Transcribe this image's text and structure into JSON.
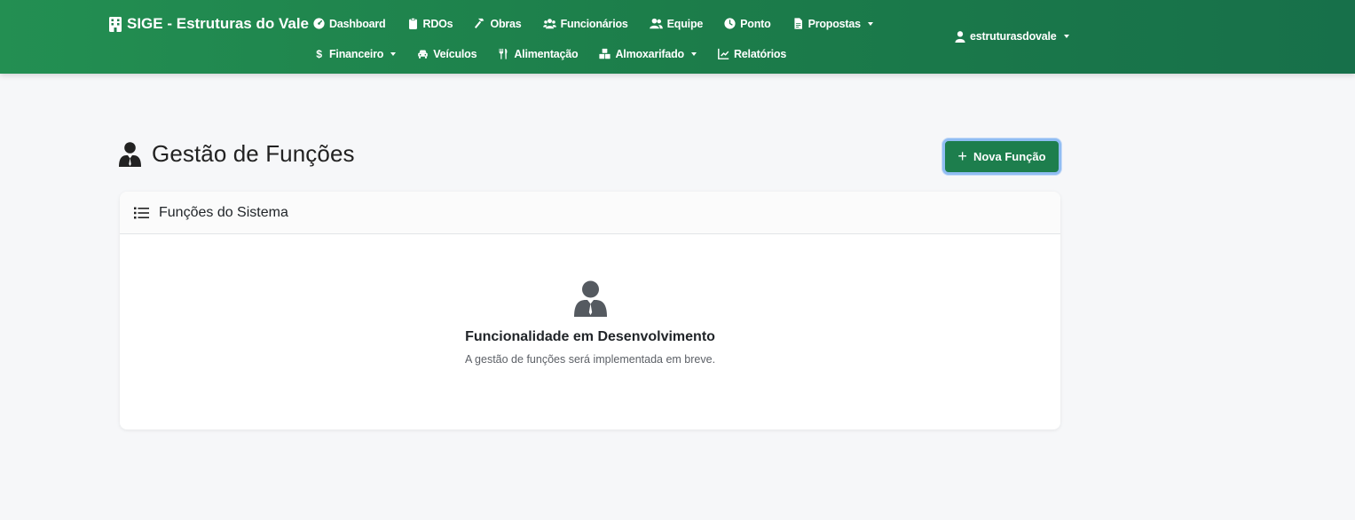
{
  "brand": {
    "title": "SIGE - Estruturas do Vale",
    "icon": "building-icon"
  },
  "nav": {
    "row1": [
      {
        "label": "Dashboard",
        "icon": "gauge-icon",
        "dropdown": false
      },
      {
        "label": "RDOs",
        "icon": "clipboard-icon",
        "dropdown": false
      },
      {
        "label": "Obras",
        "icon": "hammer-icon",
        "dropdown": false
      },
      {
        "label": "Funcionários",
        "icon": "users-icon",
        "dropdown": false
      },
      {
        "label": "Equipe",
        "icon": "user-group-icon",
        "dropdown": false
      },
      {
        "label": "Ponto",
        "icon": "clock-icon",
        "dropdown": false
      },
      {
        "label": "Propostas",
        "icon": "file-icon",
        "dropdown": true
      }
    ],
    "row2": [
      {
        "label": "Financeiro",
        "icon": "dollar-icon",
        "dropdown": true
      },
      {
        "label": "Veículos",
        "icon": "car-icon",
        "dropdown": false
      },
      {
        "label": "Alimentação",
        "icon": "utensils-icon",
        "dropdown": false
      },
      {
        "label": "Almoxarifado",
        "icon": "boxes-icon",
        "dropdown": true
      },
      {
        "label": "Relatórios",
        "icon": "chart-line-icon",
        "dropdown": false
      }
    ],
    "user": "estruturasdovale"
  },
  "page": {
    "title": "Gestão de Funções",
    "new_button": "Nova Função"
  },
  "card": {
    "header": "Funções do Sistema",
    "empty_title": "Funcionalidade em Desenvolvimento",
    "empty_subtitle": "A gestão de funções será implementada em breve."
  },
  "colors": {
    "navbar": "#1c7d4a",
    "button": "#1d7e4d",
    "button_focus_ring": "#90bdf3",
    "background": "#f6f7f9"
  }
}
